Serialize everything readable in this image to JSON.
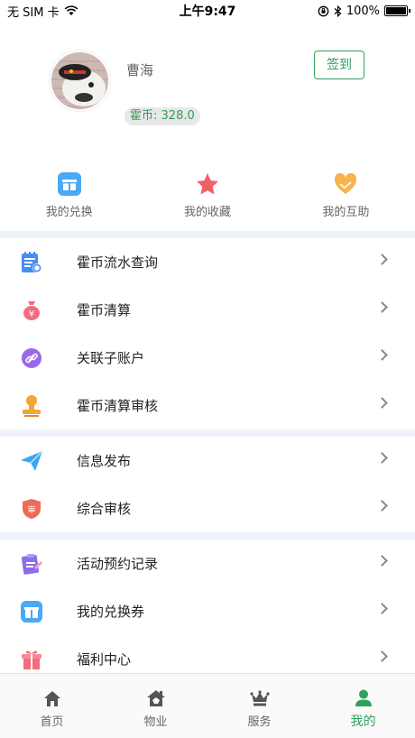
{
  "status_bar": {
    "carrier": "无 SIM 卡",
    "time": "上午9:47",
    "battery": "100%"
  },
  "profile": {
    "username": "曹海",
    "coin_label": "霍币:",
    "coin_value": "328.0",
    "signin_label": "签到"
  },
  "quick_actions": [
    {
      "label": "我的兑换",
      "icon": "gift-box-icon",
      "color": "#4aa8f5"
    },
    {
      "label": "我的收藏",
      "icon": "star-icon",
      "color": "#f0606c"
    },
    {
      "label": "我的互助",
      "icon": "heart-hands-icon",
      "color": "#f6b44a"
    }
  ],
  "menu_groups": [
    [
      {
        "label": "霍币流水查询",
        "icon": "ledger-icon",
        "color": "#4a8cf2"
      },
      {
        "label": "霍币清算",
        "icon": "money-bag-icon",
        "color": "#f36c7c"
      },
      {
        "label": "关联子账户",
        "icon": "link-icon",
        "color": "#9a68e8"
      },
      {
        "label": "霍币清算审核",
        "icon": "stamp-icon",
        "color": "#f4a635"
      }
    ],
    [
      {
        "label": "信息发布",
        "icon": "paper-plane-icon",
        "color": "#3aa7ee"
      },
      {
        "label": "综合审核",
        "icon": "audit-shield-icon",
        "color": "#f06a55"
      }
    ],
    [
      {
        "label": "活动预约记录",
        "icon": "clipboard-icon",
        "color": "#8b6ee6"
      },
      {
        "label": "我的兑换券",
        "icon": "coupon-icon",
        "color": "#4aa8f5"
      },
      {
        "label": "福利中心",
        "icon": "gift-icon",
        "color": "#f36c7c"
      }
    ]
  ],
  "tabbar": [
    {
      "label": "首页",
      "icon": "home-icon",
      "active": false
    },
    {
      "label": "物业",
      "icon": "property-icon",
      "active": false
    },
    {
      "label": "服务",
      "icon": "crown-icon",
      "active": false
    },
    {
      "label": "我的",
      "icon": "user-icon",
      "active": true
    }
  ],
  "colors": {
    "accent": "#2fa15a",
    "separator": "#eef3fa"
  }
}
